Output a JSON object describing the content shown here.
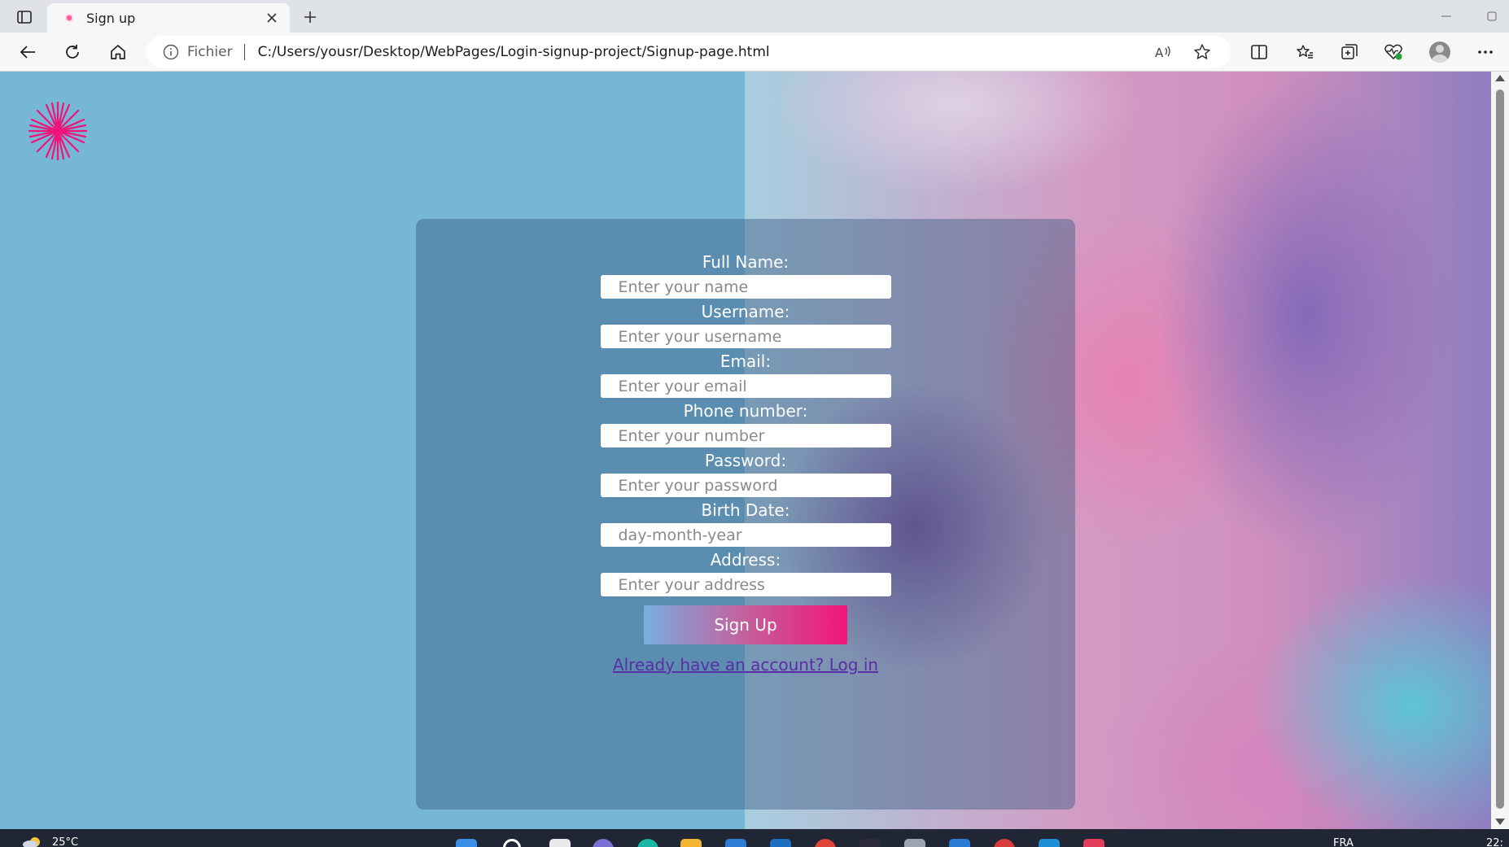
{
  "browser": {
    "tab_title": "Sign up",
    "address_scheme": "Fichier",
    "address_url": "C:/Users/yousr/Desktop/WebPages/Login-signup-project/Signup-page.html"
  },
  "signup_form": {
    "fields": [
      {
        "label": "Full Name:",
        "placeholder": "Enter your name"
      },
      {
        "label": "Username:",
        "placeholder": "Enter your username"
      },
      {
        "label": "Email:",
        "placeholder": "Enter your email"
      },
      {
        "label": "Phone number:",
        "placeholder": "Enter your number"
      },
      {
        "label": "Password:",
        "placeholder": "Enter your password"
      },
      {
        "label": "Birth Date:",
        "placeholder": "day-month-year"
      },
      {
        "label": "Address:",
        "placeholder": "Enter your address"
      }
    ],
    "submit_label": "Sign Up",
    "login_link": "Already have an account? Log in"
  },
  "taskbar": {
    "temperature": "25°C",
    "language": "FRA",
    "clock": "22:"
  },
  "colors": {
    "accent_pink": "#f0147a",
    "page_blue": "#76b7d5",
    "link_purple": "#5a2ea5"
  },
  "icons": {
    "tab_actions": "tab-actions-icon",
    "new_tab": "plus-icon",
    "back": "back-arrow-icon",
    "refresh": "refresh-icon",
    "home": "home-icon",
    "info": "info-icon",
    "read_aloud": "read-aloud-icon",
    "favorite": "star-icon",
    "split_screen": "split-screen-icon",
    "favorites": "favorites-list-icon",
    "collections": "collections-icon",
    "browser_essentials": "heartbeat-icon",
    "profile": "avatar",
    "more": "more-dots-icon",
    "logo": "starburst-logo-icon"
  }
}
